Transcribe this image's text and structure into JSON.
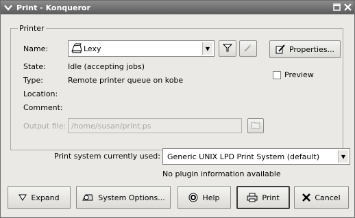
{
  "window": {
    "title": "Print - Konqueror"
  },
  "printer_group": {
    "legend": "Printer",
    "name_label": "Name:",
    "selected_printer": "Lexy",
    "properties_label": "Properties...",
    "preview_label": "Preview",
    "state_label": "State:",
    "state_value": "Idle (accepting jobs)",
    "type_label": "Type:",
    "type_value": "Remote printer queue on kobe",
    "location_label": "Location:",
    "location_value": "",
    "comment_label": "Comment:",
    "comment_value": "",
    "output_file_label": "Output file:",
    "output_file_value": "/home/susan/print.ps"
  },
  "print_system": {
    "label": "Print system currently used:",
    "selected": "Generic UNIX LPD Print System (default)",
    "plugin_info": "No plugin information available"
  },
  "buttons": {
    "expand": "Expand",
    "system_options": "System Options...",
    "help": "Help",
    "print": "Print",
    "cancel": "Cancel"
  }
}
